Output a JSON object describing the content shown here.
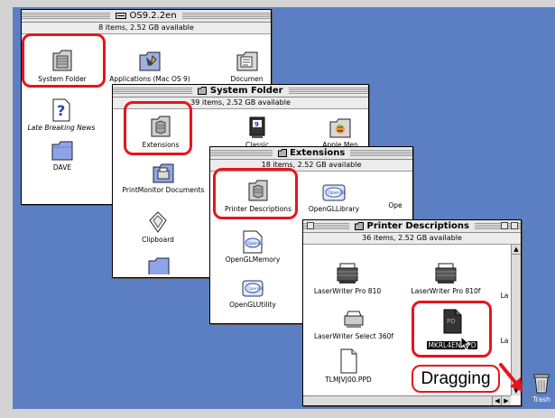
{
  "windows": {
    "os_volume": {
      "title": "OS9.2.2en",
      "info": "8 items, 2.52 GB available"
    },
    "system_folder": {
      "title": "System Folder",
      "info": "39 items, 2.52 GB available"
    },
    "extensions": {
      "title": "Extensions",
      "info": "18 items, 2.52 GB available"
    },
    "printer_descriptions": {
      "title": "Printer Descriptions",
      "info": "36 items, 2.52 GB available"
    }
  },
  "os_items": {
    "system_folder": "System Folder",
    "applications": "Applications (Mac OS 9)",
    "documents": "Documen",
    "late_breaking": "Late Breaking News",
    "dave": "DAVE"
  },
  "sys_items": {
    "extensions": "Extensions",
    "classic": "Classic",
    "apple_menu": "Apple Men",
    "printmonitor": "PrintMonitor Documents",
    "clipboard": "Clipboard"
  },
  "ext_items": {
    "printer_desc": "Printer Descriptions",
    "opengl_library": "OpenGLLibrary",
    "ope_partial": "Ope",
    "opengl_memory": "OpenGLMemory",
    "opengl_utility": "OpenGLUtility"
  },
  "pd_items": {
    "lw_pro_810": "LaserWriter Pro 810",
    "lw_pro_810f": "LaserWriter Pro 810f",
    "la_partial_1": "La",
    "lw_select_360f": "LaserWriter Select 360f",
    "mkrl4en": "MKRL4EN.PPD",
    "la_partial_2": "La",
    "tlmjvj00": "TLMJVJ00.PPD"
  },
  "callout": {
    "dragging": "Dragging"
  },
  "desktop": {
    "trash": "Trash"
  },
  "colors": {
    "highlight": "#e8141b",
    "desktop": "#5b7fc2"
  }
}
